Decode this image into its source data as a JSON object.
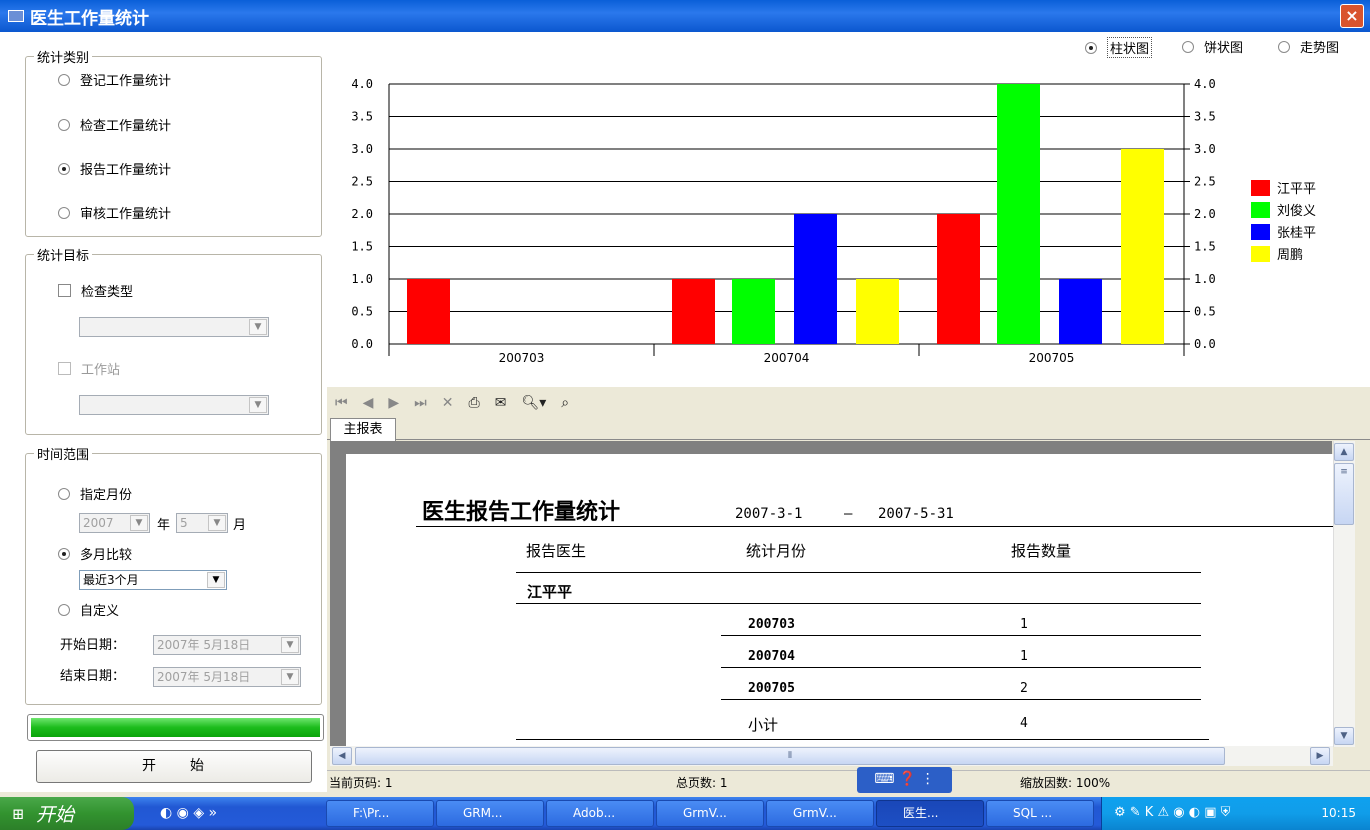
{
  "window": {
    "title": "医生工作量统计",
    "close_symbol": "×"
  },
  "stat_type": {
    "legend": "统计类别",
    "options": [
      {
        "label": "登记工作量统计",
        "selected": false
      },
      {
        "label": "检查工作量统计",
        "selected": false
      },
      {
        "label": "报告工作量统计",
        "selected": true
      },
      {
        "label": "审核工作量统计",
        "selected": false
      }
    ]
  },
  "stat_target": {
    "legend": "统计目标",
    "exam_type_label": "检查类型",
    "workstation_label": "工作站",
    "exam_type_value": "",
    "workstation_value": ""
  },
  "time_range": {
    "legend": "时间范围",
    "specific_month_label": "指定月份",
    "year_value": "2007",
    "year_unit": "年",
    "month_value": "5",
    "month_unit": "月",
    "multi_month_label": "多月比较",
    "multi_month_value": "最近3个月",
    "custom_label": "自定义",
    "start_date_label": "开始日期：",
    "start_date_value": "2007年 5月18日",
    "end_date_label": "结束日期：",
    "end_date_value": "2007年 5月18日",
    "selected": "multi_month"
  },
  "progress": {
    "value": 1.0
  },
  "start_button": {
    "label": "开　　始"
  },
  "chart_type_options": [
    {
      "label": "柱状图",
      "selected": true
    },
    {
      "label": "饼状图",
      "selected": false
    },
    {
      "label": "走势图",
      "selected": false
    }
  ],
  "chart_data": {
    "type": "bar",
    "categories": [
      "200703",
      "200704",
      "200705"
    ],
    "series": [
      {
        "name": "江平平",
        "color": "#ff0000",
        "values": [
          1,
          1,
          2
        ]
      },
      {
        "name": "刘俊义",
        "color": "#00ff00",
        "values": [
          0,
          1,
          4
        ]
      },
      {
        "name": "张桂平",
        "color": "#0000ff",
        "values": [
          0,
          2,
          1
        ]
      },
      {
        "name": "周鹏",
        "color": "#ffff00",
        "values": [
          0,
          1,
          3
        ]
      }
    ],
    "yticks": [
      "0.0",
      "0.5",
      "1.0",
      "1.5",
      "2.0",
      "2.5",
      "3.0",
      "3.5",
      "4.0"
    ],
    "ylim": [
      0,
      4
    ],
    "grid": true,
    "legend_position": "right"
  },
  "report_tab": {
    "label": "主报表"
  },
  "report": {
    "title": "医生报告工作量统计",
    "date_from": "2007-3-1",
    "date_sep": "—",
    "date_to": "2007-5-31",
    "col_doctor": "报告医生",
    "col_month": "统计月份",
    "col_count": "报告数量",
    "doctor": "江平平",
    "rows": [
      {
        "month": "200703",
        "count": "1"
      },
      {
        "month": "200704",
        "count": "1"
      },
      {
        "month": "200705",
        "count": "2"
      }
    ],
    "subtotal_label": "小计",
    "subtotal_value": "4"
  },
  "status": {
    "current_page": "当前页码: 1",
    "total_pages": "总页数: 1",
    "zoom": "缩放因数: 100%"
  },
  "taskbar": {
    "start_label": "开始",
    "tasks": [
      "F:\\Pr...",
      "GRM...",
      "Adob...",
      "GrmV...",
      "GrmV...",
      "医生...",
      "SQL ..."
    ],
    "clock": "10:15"
  }
}
